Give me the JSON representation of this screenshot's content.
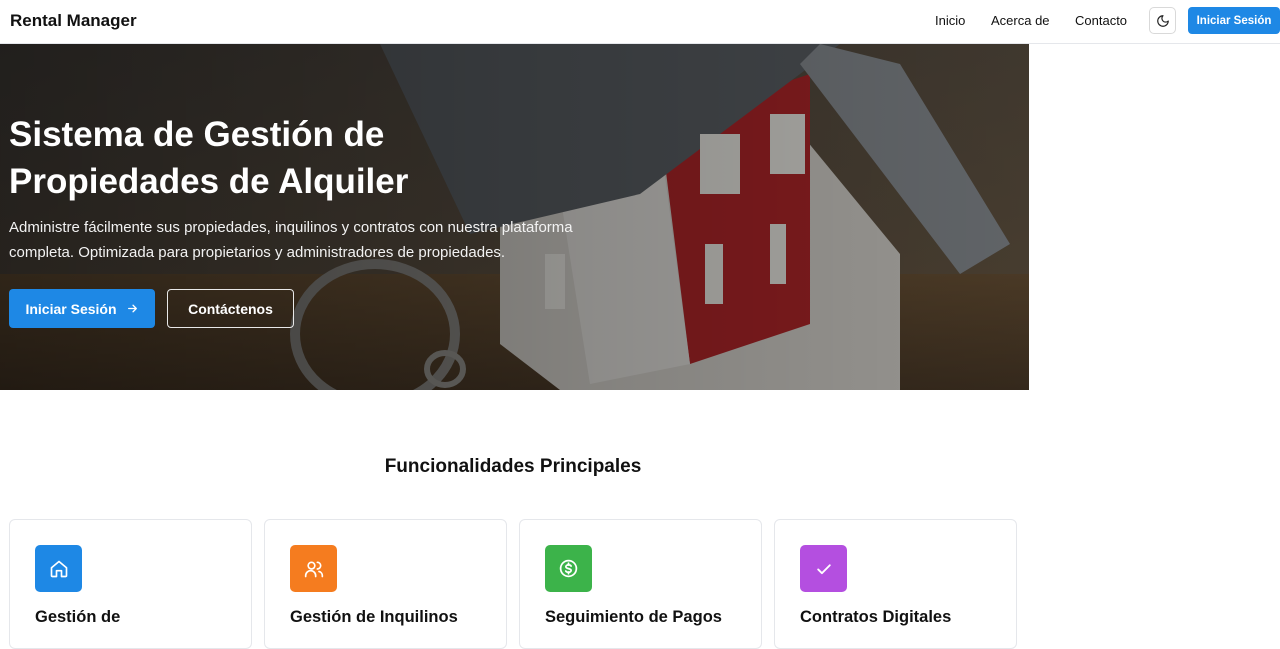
{
  "header": {
    "brand": "Rental Manager",
    "nav": [
      "Inicio",
      "Acerca de",
      "Contacto"
    ],
    "theme_icon": "moon-icon",
    "login_label": "Iniciar Sesión"
  },
  "hero": {
    "title_line1": "Sistema de Gestión de",
    "title_line2": "Propiedades de Alquiler",
    "description": "Administre fácilmente sus propiedades, inquilinos y contratos con nuestra plataforma completa. Optimizada para propietarios y administradores de propiedades.",
    "primary_label": "Iniciar Sesión",
    "primary_icon": "arrow-right-icon",
    "secondary_label": "Contáctenos"
  },
  "features": {
    "title": "Funcionalidades Principales",
    "cards": [
      {
        "title": "Gestión de",
        "icon": "home-icon",
        "color": "#1e88e5"
      },
      {
        "title": "Gestión de Inquilinos",
        "icon": "users-icon",
        "color": "#f57c1f"
      },
      {
        "title": "Seguimiento de Pagos",
        "icon": "dollar-circle-icon",
        "color": "#3cb34a"
      },
      {
        "title": "Contratos Digitales",
        "icon": "check-icon",
        "color": "#b44fe0"
      }
    ]
  },
  "colors": {
    "accent": "#1e88e5"
  }
}
